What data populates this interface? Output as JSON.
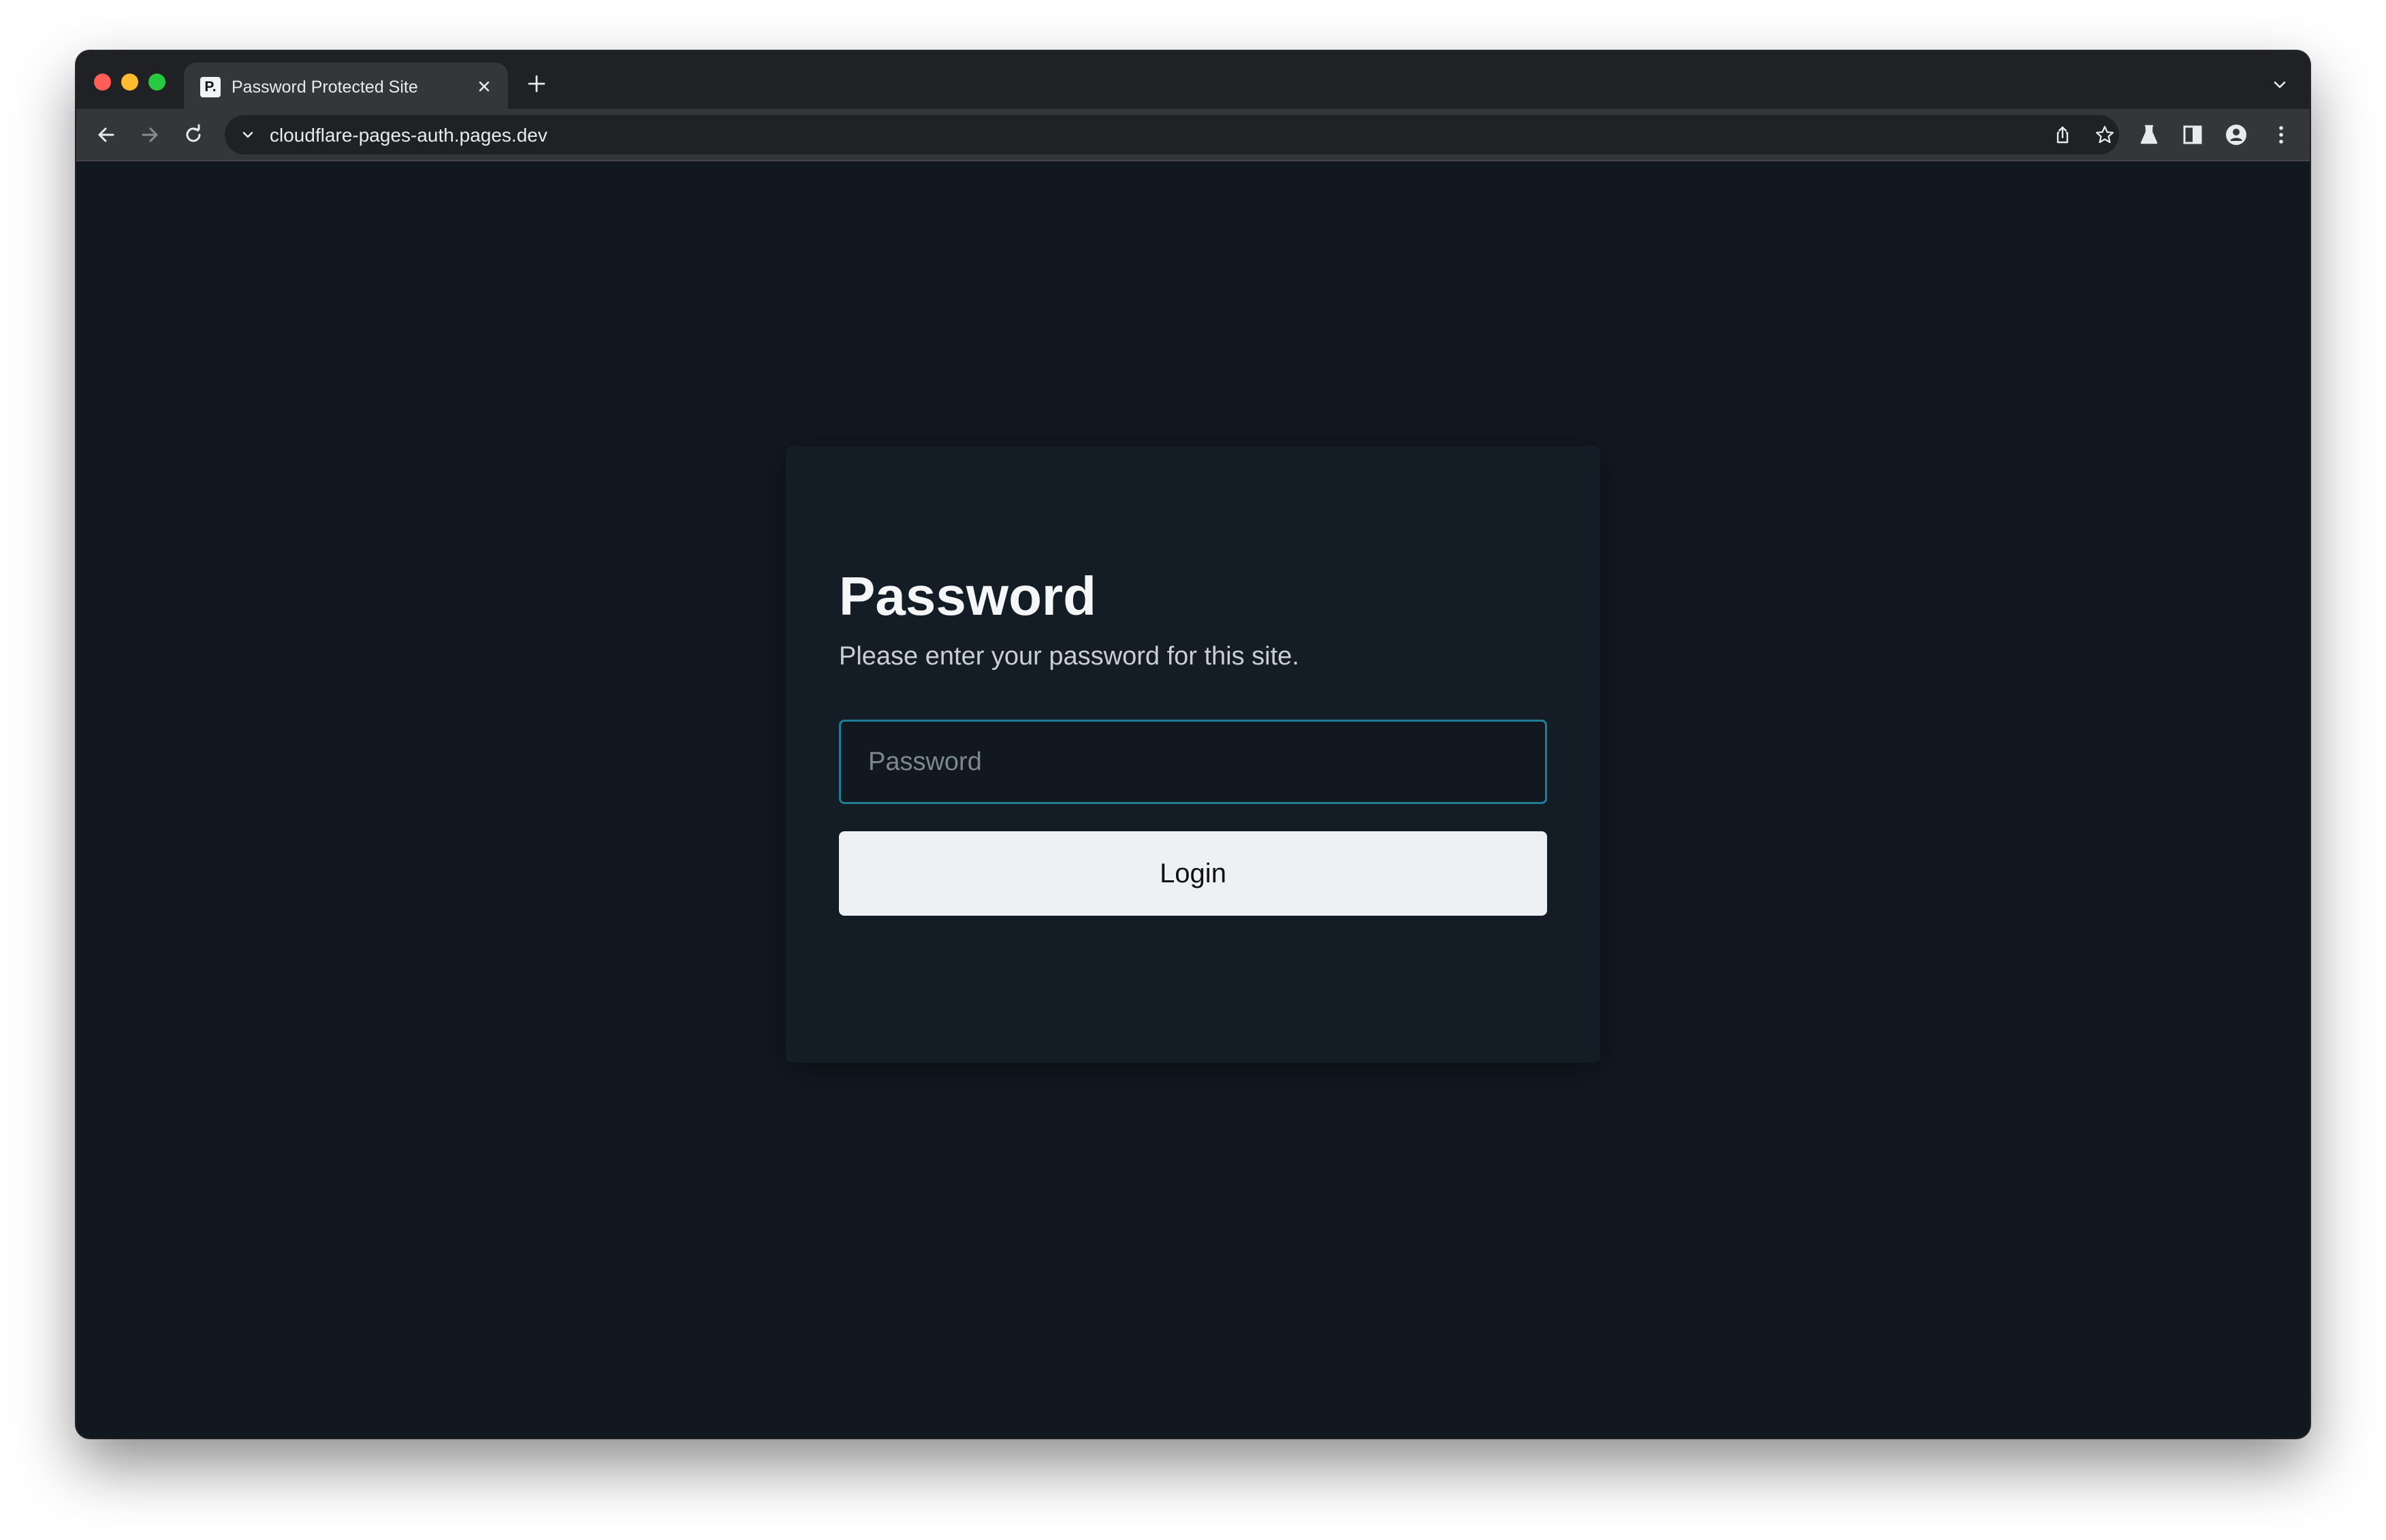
{
  "browser": {
    "tab": {
      "favicon_text": "P.",
      "title": "Password Protected Site"
    },
    "omnibox": {
      "url": "cloudflare-pages-auth.pages.dev"
    },
    "icons": {
      "back": "arrow-left-icon",
      "forward": "arrow-right-icon",
      "reload": "reload-icon",
      "share": "share-icon",
      "bookmark": "star-icon",
      "labs": "flask-icon",
      "sidepanel": "side-panel-icon",
      "profile": "profile-icon",
      "menu": "kebab-menu-icon"
    },
    "colors": {
      "traffic_red": "#ff5f57",
      "traffic_yellow": "#febc2e",
      "traffic_green": "#28c840"
    }
  },
  "page": {
    "title": "Password",
    "subtitle": "Please enter your password for this site.",
    "password_input": {
      "placeholder": "Password",
      "value": ""
    },
    "login_button": {
      "label": "Login"
    },
    "colors": {
      "background": "#111820",
      "card": "#141d26",
      "input_focus_border": "#1f7f96",
      "button_bg": "#eef1f4"
    }
  }
}
